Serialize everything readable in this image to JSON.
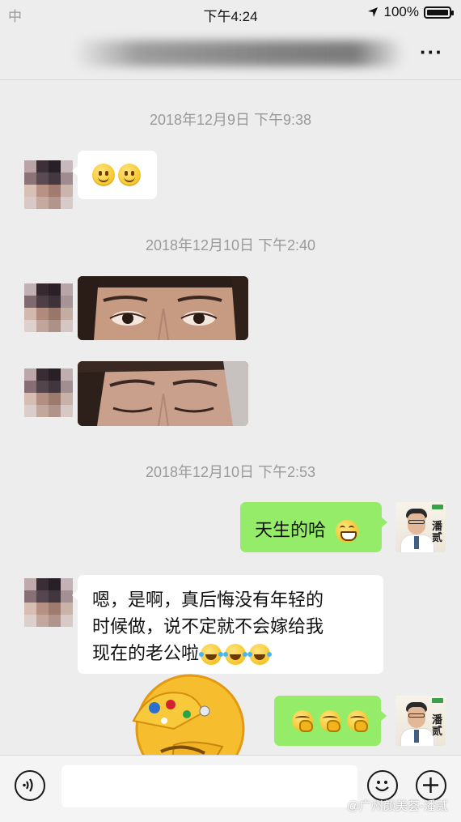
{
  "status_bar": {
    "carrier": "中",
    "time": "下午4:24",
    "battery": "100%"
  },
  "nav": {
    "more_label": "···"
  },
  "timestamps": [
    "2018年12月9日 下午9:38",
    "2018年12月10日 下午2:40",
    "2018年12月10日 下午2:53"
  ],
  "messages": {
    "reply_line_1": "嗯，是啊，真后悔没有年轻的",
    "reply_line_2": "时候做，说不定就不会嫁给我",
    "reply_line_3": "现在的老公啦",
    "natural_text": "天生的哈"
  },
  "my_avatar_text": "潘贰",
  "watermark": "@广州颜美荟-潘贰",
  "icons": [
    "voice-icon",
    "emoji-icon",
    "plus-icon",
    "more-icon"
  ],
  "colors": {
    "background": "#ededed",
    "my_bubble": "#95ec69",
    "other_bubble": "#ffffff",
    "timestamp_text": "#9a9a9a"
  }
}
